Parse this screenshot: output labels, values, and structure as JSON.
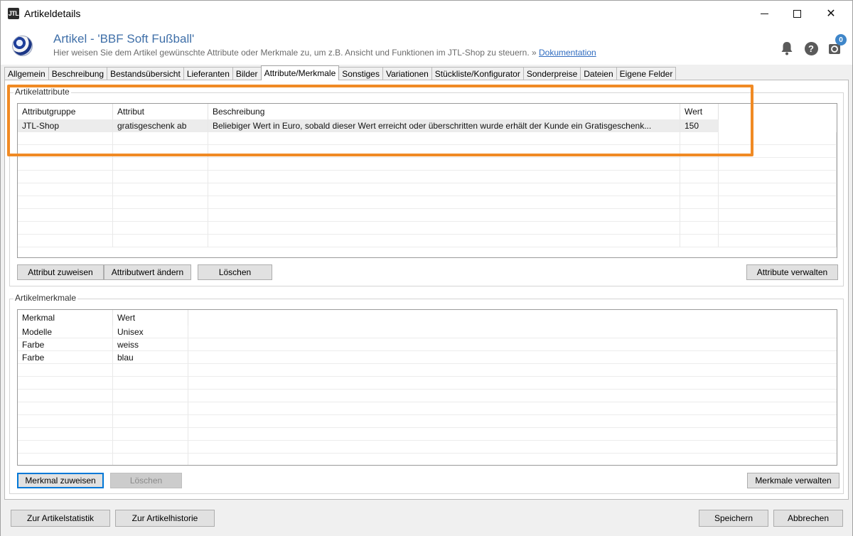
{
  "window": {
    "title": "Artikeldetails",
    "app_icon_text": "JTL"
  },
  "header": {
    "title": "Artikel - 'BBF Soft Fußball'",
    "subtitle": "Hier weisen Sie dem Artikel gewünschte Attribute oder Merkmale zu, um z.B. Ansicht und Funktionen im JTL-Shop zu steuern. » ",
    "doc_link": "Dokumentation",
    "badge_count": "0"
  },
  "tabs": [
    {
      "label": "Allgemein"
    },
    {
      "label": "Beschreibung"
    },
    {
      "label": "Bestandsübersicht"
    },
    {
      "label": "Lieferanten"
    },
    {
      "label": "Bilder"
    },
    {
      "label": "Attribute/Merkmale"
    },
    {
      "label": "Sonstiges"
    },
    {
      "label": "Variationen"
    },
    {
      "label": "Stückliste/Konfigurator"
    },
    {
      "label": "Sonderpreise"
    },
    {
      "label": "Dateien"
    },
    {
      "label": "Eigene Felder"
    }
  ],
  "attributes": {
    "legend": "Artikelattribute",
    "columns": [
      "Attributgruppe",
      "Attribut",
      "Beschreibung",
      "Wert"
    ],
    "rows": [
      [
        "JTL-Shop",
        "gratisgeschenk ab",
        "Beliebiger Wert in Euro, sobald dieser Wert erreicht oder überschritten wurde erhält der Kunde ein Gratisgeschenk...",
        "150"
      ]
    ],
    "buttons": {
      "assign": "Attribut zuweisen",
      "change": "Attributwert ändern",
      "delete": "Löschen",
      "manage": "Attribute verwalten"
    }
  },
  "features": {
    "legend": "Artikelmerkmale",
    "columns": [
      "Merkmal",
      "Wert"
    ],
    "rows": [
      [
        "Modelle",
        "Unisex"
      ],
      [
        "Farbe",
        "weiss"
      ],
      [
        "Farbe",
        "blau"
      ]
    ],
    "buttons": {
      "assign": "Merkmal zuweisen",
      "delete": "Löschen",
      "manage": "Merkmale verwalten"
    }
  },
  "footer": {
    "stats": "Zur Artikelstatistik",
    "history": "Zur Artikelhistorie",
    "save": "Speichern",
    "cancel": "Abbrechen"
  },
  "colors": {
    "highlight": "#f08a24",
    "title_blue": "#3f6fa8",
    "link": "#2f6bbf",
    "badge": "#3f86c9"
  }
}
